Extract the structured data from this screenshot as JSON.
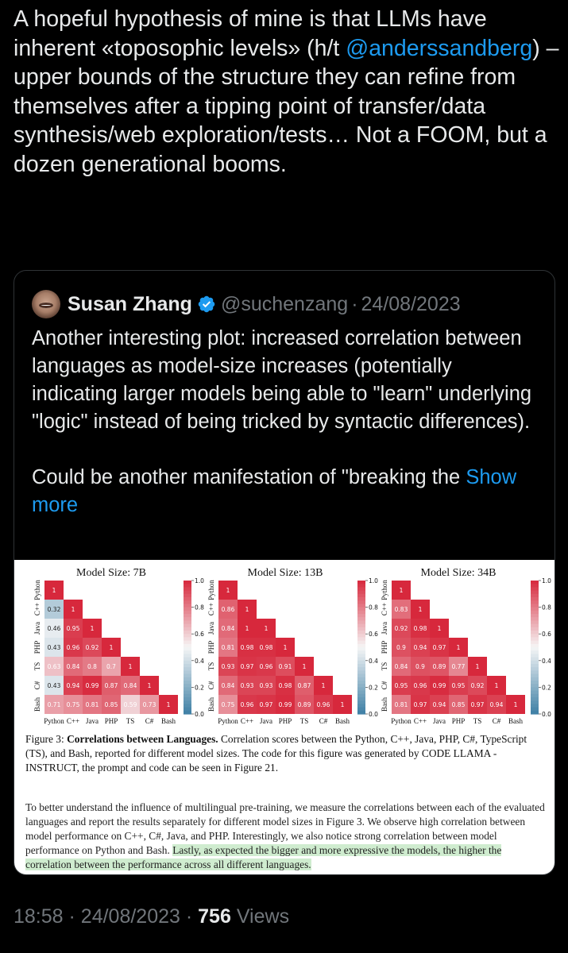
{
  "tweet": {
    "text_before": "A hopeful hypothesis of mine is that LLMs have inherent «toposophic levels» (h/t ",
    "mention": "@anderssandberg",
    "text_after": ") – upper bounds of the structure they can refine from themselves after a tipping point of transfer/data synthesis/web exploration/tests… Not a FOOM, but a dozen generational booms."
  },
  "quote": {
    "name": "Susan Zhang",
    "handle": "@suchenzang",
    "separator": "·",
    "date": "24/08/2023",
    "paragraph1": "Another interesting plot: increased correlation between languages as model-size increases (potentially indicating larger models being able to \"learn\" underlying \"logic\" instead of being tricked by syntactic differences).",
    "paragraph2": "Could be another manifestation of \"breaking the ",
    "show_more": "Show more"
  },
  "paper": {
    "caption_prefix": "Figure 3: ",
    "caption_bold": "Correlations between Languages.",
    "caption_rest": " Correlation scores between the Python, C++, Java, PHP, C#, TypeScript (TS), and Bash, reported for different model sizes. The code for this figure was generated by CODE LLAMA - INSTRUCT, the prompt and code can be seen in Figure 21.",
    "para_plain": "To better understand the influence of multilingual pre-training, we measure the correlations between each of the evaluated languages and report the results separately for different model sizes in Figure 3. We observe high correlation between model performance on C++, C#, Java, and PHP. Interestingly, we also notice strong correlation between model performance on Python and Bash. ",
    "para_highlight": "Lastly, as expected the bigger and more expressive the models, the higher the correlation between the performance across all different languages."
  },
  "footer": {
    "time": "18:58",
    "separator": "·",
    "date": "24/08/2023",
    "views_count": "756",
    "views_label": "Views"
  },
  "colors": {
    "background": "#000000",
    "text": "#e7e9ea",
    "muted": "#71767b",
    "link": "#1d9bf0",
    "border": "#2f3336",
    "heat_high": "#d7283c",
    "heat_low": "#3d7fa5"
  },
  "chart_data": [
    {
      "type": "heatmap",
      "title": "Model Size: 7B",
      "labels": [
        "Python",
        "C++",
        "Java",
        "PHP",
        "TS",
        "C#",
        "Bash"
      ],
      "rows": [
        [
          1
        ],
        [
          0.32,
          1
        ],
        [
          0.46,
          0.95,
          1
        ],
        [
          0.43,
          0.96,
          0.92,
          1
        ],
        [
          0.63,
          0.84,
          0.8,
          0.7,
          1
        ],
        [
          0.43,
          0.94,
          0.99,
          0.87,
          0.84,
          1
        ],
        [
          0.71,
          0.75,
          0.81,
          0.85,
          0.59,
          0.73,
          1
        ]
      ],
      "colorbar_ticks": [
        "1.0",
        "0.8",
        "0.6",
        "0.4",
        "0.2",
        "0.0"
      ],
      "range": [
        0,
        1
      ]
    },
    {
      "type": "heatmap",
      "title": "Model Size: 13B",
      "labels": [
        "Python",
        "C++",
        "Java",
        "PHP",
        "TS",
        "C#",
        "Bash"
      ],
      "rows": [
        [
          1
        ],
        [
          0.86,
          1
        ],
        [
          0.84,
          1,
          1
        ],
        [
          0.81,
          0.98,
          0.98,
          1
        ],
        [
          0.93,
          0.97,
          0.96,
          0.91,
          1
        ],
        [
          0.84,
          0.93,
          0.93,
          0.98,
          0.87,
          1
        ],
        [
          0.75,
          0.96,
          0.97,
          0.99,
          0.89,
          0.96,
          1
        ]
      ],
      "colorbar_ticks": [
        "1.0",
        "0.8",
        "0.6",
        "0.4",
        "0.2",
        "0.0"
      ],
      "range": [
        0,
        1
      ]
    },
    {
      "type": "heatmap",
      "title": "Model Size: 34B",
      "labels": [
        "Python",
        "C++",
        "Java",
        "PHP",
        "TS",
        "C#",
        "Bash"
      ],
      "rows": [
        [
          1
        ],
        [
          0.83,
          1
        ],
        [
          0.92,
          0.98,
          1
        ],
        [
          0.9,
          0.94,
          0.97,
          1
        ],
        [
          0.84,
          0.9,
          0.89,
          0.77,
          1
        ],
        [
          0.95,
          0.96,
          0.99,
          0.95,
          0.92,
          1
        ],
        [
          0.81,
          0.97,
          0.94,
          0.85,
          0.97,
          0.94,
          1
        ]
      ],
      "colorbar_ticks": [
        "1.0",
        "0.8",
        "0.6",
        "0.4",
        "0.2",
        "0.0"
      ],
      "range": [
        0,
        1
      ]
    }
  ]
}
